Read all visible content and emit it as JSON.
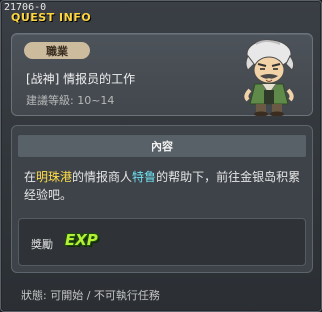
{
  "quest_id": "21706-0",
  "window_title": "QUEST INFO",
  "info": {
    "job_label": "職業",
    "quest_name": "[战神] 情报员的工作",
    "level_text": "建議等級: 10~14",
    "npc_icon": "npc-portrait-icon"
  },
  "content": {
    "header": "內容",
    "text_parts": {
      "p1": "在",
      "place": "明珠港",
      "p2": "的情报商人",
      "npc": "特鲁",
      "p3": "的帮助下，前往金银岛积累经验吧。"
    },
    "reward_label": "獎勵",
    "reward_exp": "EXP"
  },
  "status": "狀態: 可開始 / 不可執行任務",
  "colors": {
    "title": "#ffd640",
    "place_highlight": "#ffde47",
    "npc_highlight": "#6fe0f0",
    "exp": "#b4f035"
  }
}
